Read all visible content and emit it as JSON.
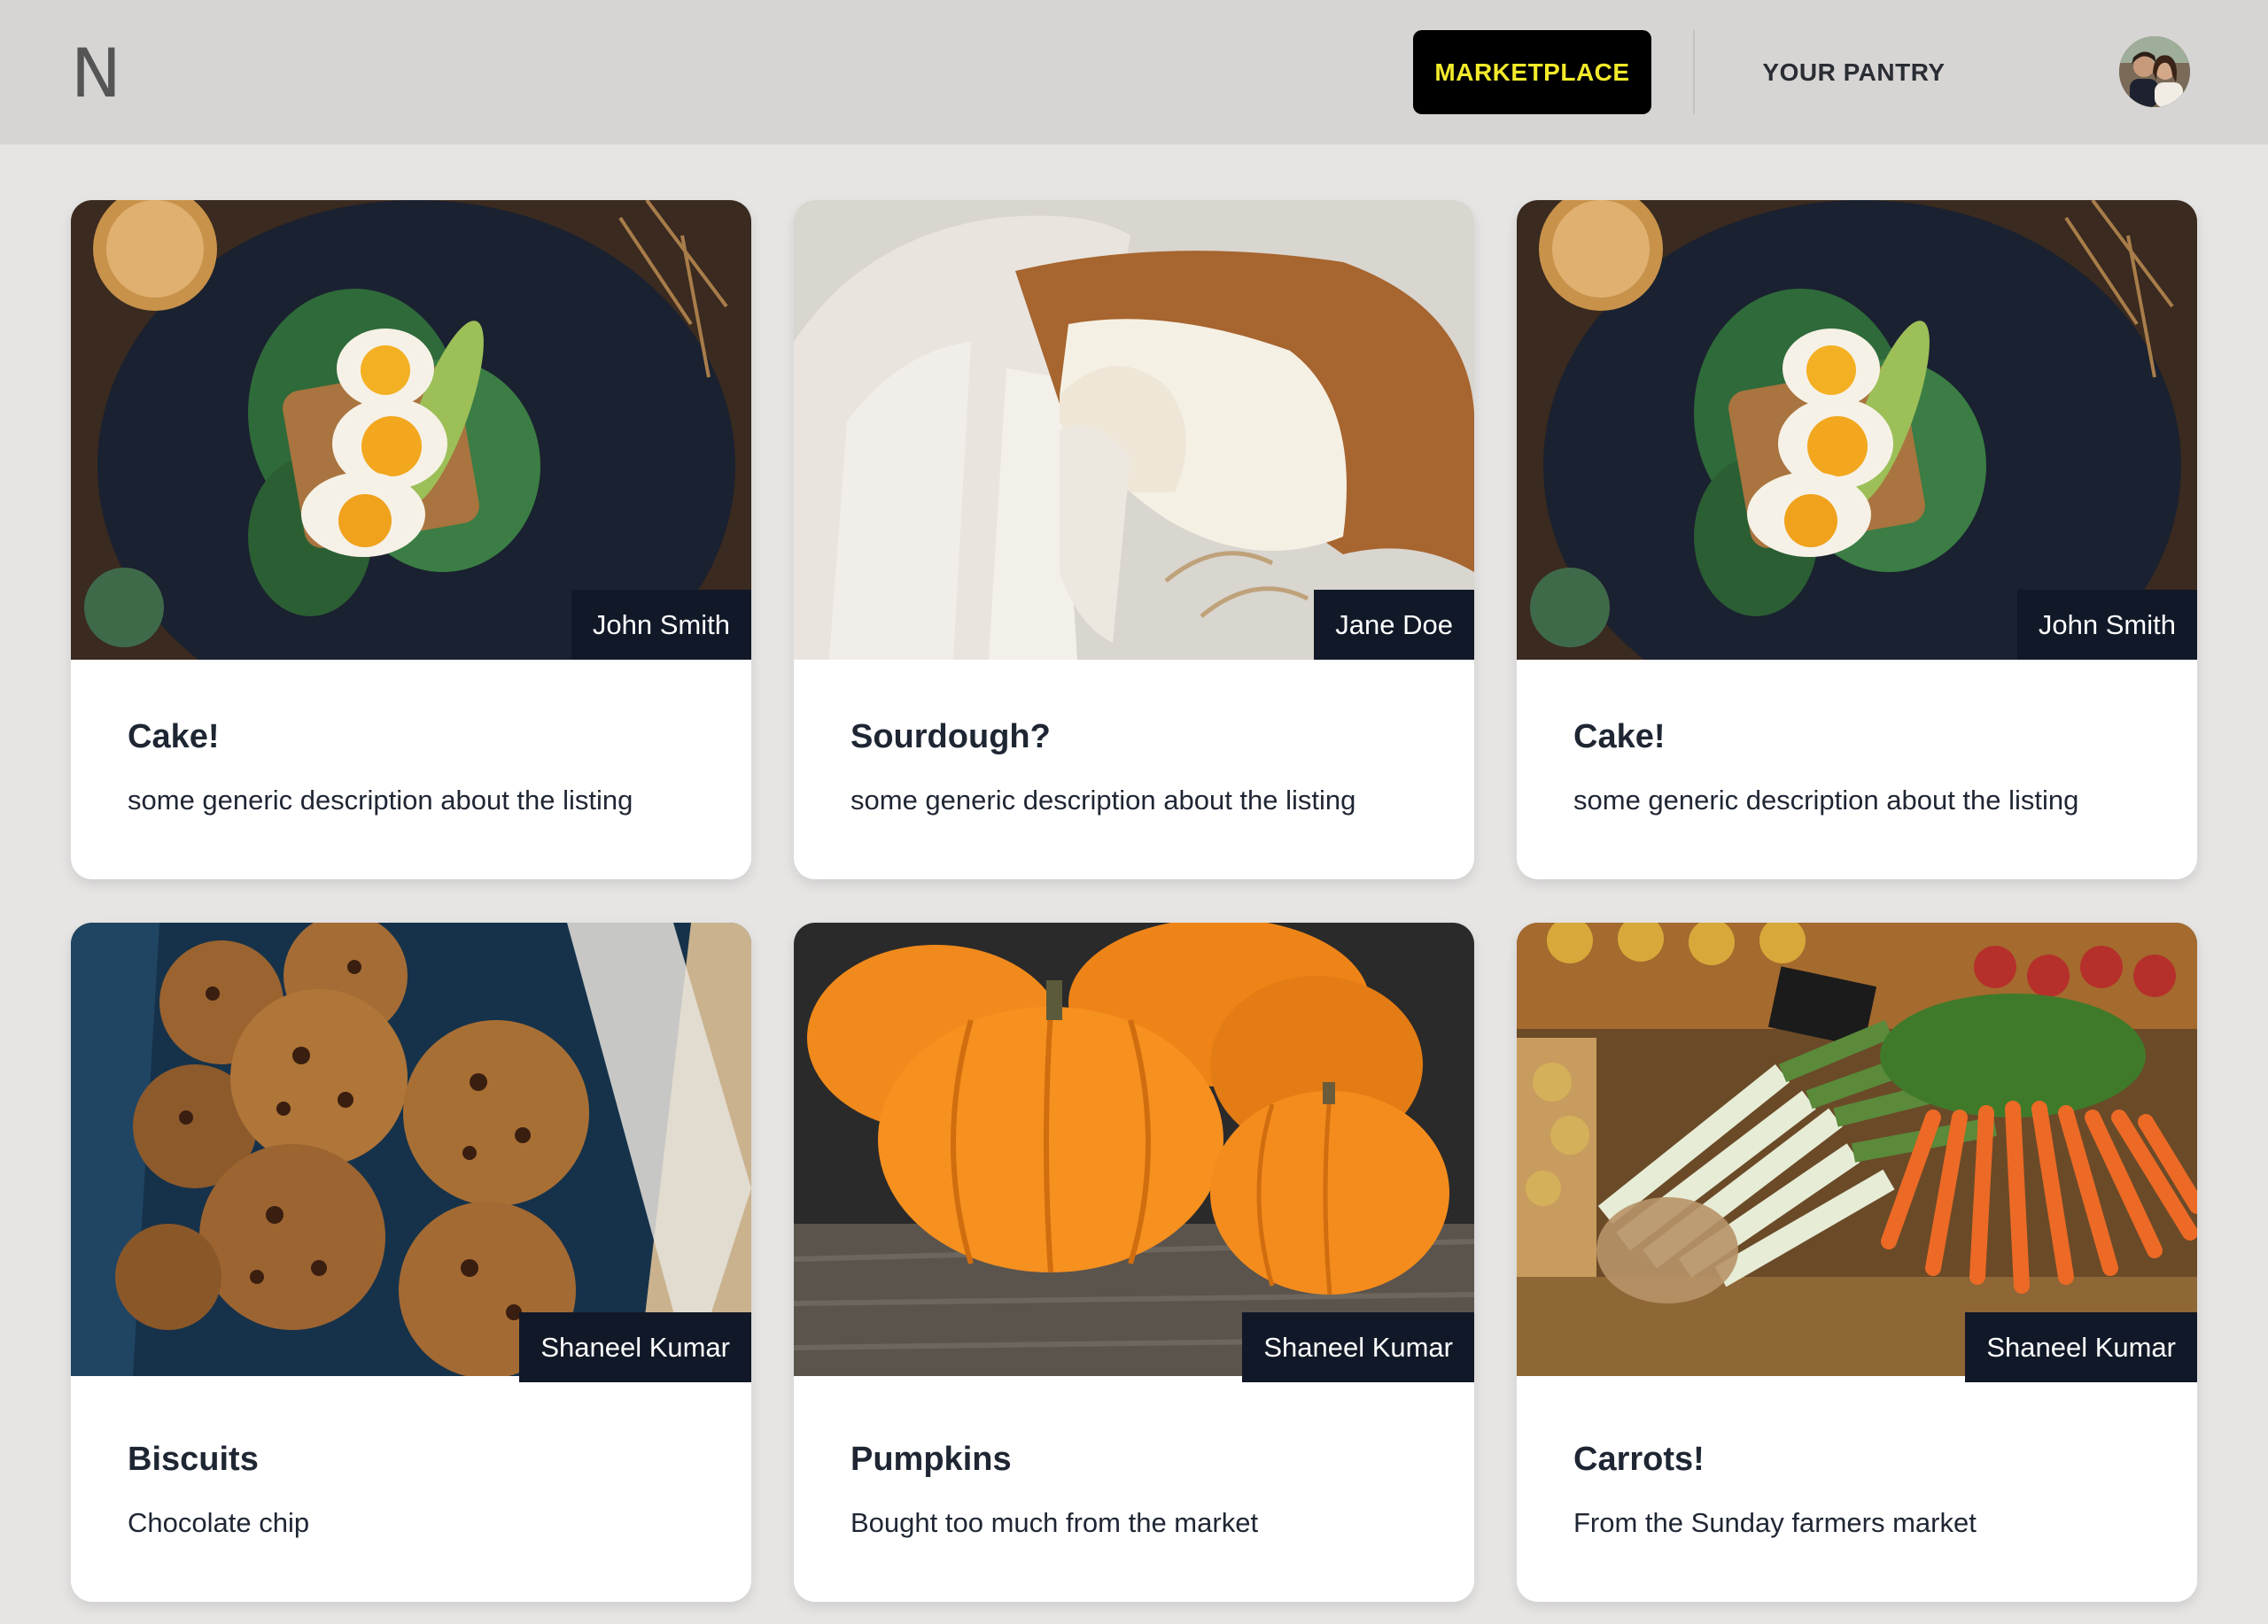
{
  "header": {
    "logo": "N",
    "nav": {
      "marketplace": "MARKETPLACE",
      "pantry": "YOUR PANTRY"
    },
    "accent_color": "#f2ea2a"
  },
  "listings": [
    {
      "seller": "John Smith",
      "title": "Cake!",
      "description": "some generic description about the listing",
      "image": "egg-toast"
    },
    {
      "seller": "Jane Doe",
      "title": "Sourdough?",
      "description": "some generic description about the listing",
      "image": "sourdough-bread"
    },
    {
      "seller": "John Smith",
      "title": "Cake!",
      "description": "some generic description about the listing",
      "image": "egg-toast"
    },
    {
      "seller": "Shaneel Kumar",
      "title": "Biscuits",
      "description": "Chocolate chip",
      "image": "cookies"
    },
    {
      "seller": "Shaneel Kumar",
      "title": "Pumpkins",
      "description": "Bought too much from the market",
      "image": "pumpkins"
    },
    {
      "seller": "Shaneel Kumar",
      "title": "Carrots!",
      "description": "From the Sunday farmers market",
      "image": "carrots-leeks"
    }
  ]
}
